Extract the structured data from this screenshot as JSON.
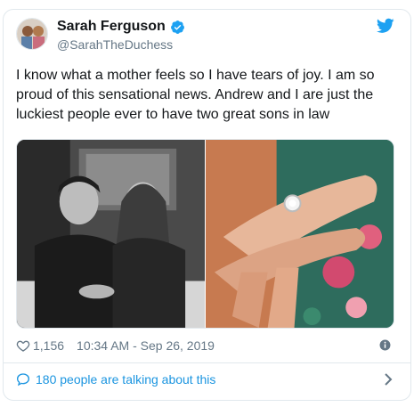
{
  "tweet": {
    "author_name": "Sarah Ferguson",
    "author_handle": "@SarahTheDuchess",
    "verified": true,
    "text": "I know what a mother feels so I have tears of joy. I am so proud of this sensational news. Andrew and I are just the luckiest people ever to have two great sons in law",
    "like_count": "1,156",
    "timestamp": "10:34 AM - Sep 26, 2019",
    "talking_link": "180 people are talking about this"
  },
  "icons": {
    "verified": "verified-badge-icon",
    "platform": "twitter-bird-icon",
    "like": "heart-icon",
    "info": "info-icon",
    "reply": "speech-bubble-icon",
    "more": "chevron-right-icon"
  },
  "colors": {
    "accent": "#1da1f2",
    "link": "#1b95e0",
    "muted": "#657786",
    "border": "#e1e8ed",
    "text": "#14171a"
  }
}
